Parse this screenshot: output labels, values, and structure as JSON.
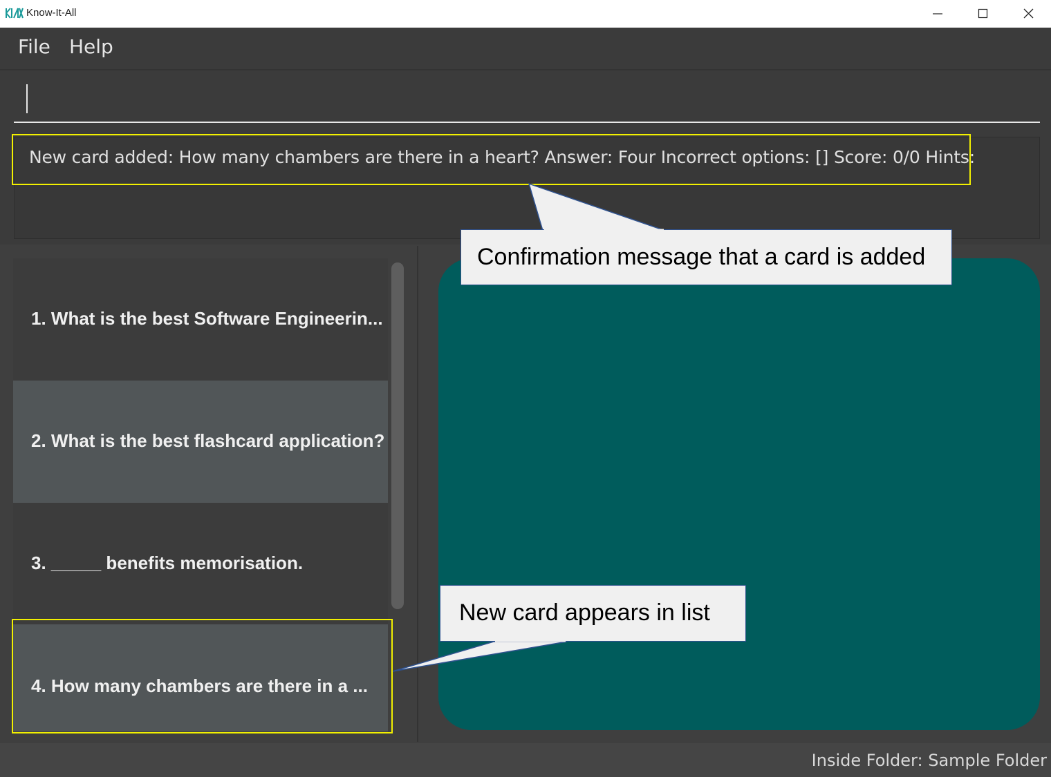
{
  "window": {
    "title": "Know-It-All",
    "icon": "kia-logo-icon",
    "controls": [
      "minimize-icon",
      "maximize-icon",
      "close-icon"
    ]
  },
  "menu": {
    "items": [
      {
        "label": "File"
      },
      {
        "label": "Help"
      }
    ]
  },
  "command_box": {
    "value": "",
    "placeholder": ""
  },
  "result_display": {
    "text": "New card added: How many chambers are there in a heart? Answer: Four Incorrect options: [] Score: 0/0 Hints:"
  },
  "card_list": {
    "items": [
      {
        "label": "1.  What is the best Software Engineerin..."
      },
      {
        "label": "2.  What is the best flashcard application?"
      },
      {
        "label": "3.  _____ benefits memorisation."
      },
      {
        "label": "4.  How many chambers are there in a ..."
      }
    ]
  },
  "annotations": {
    "callout_result": "Confirmation message that a card is added",
    "callout_list": "New card appears in list"
  },
  "status_bar": {
    "folder": "Inside Folder: Sample Folder"
  },
  "colors": {
    "background": "#3f3f3f",
    "display_card": "#005c5c",
    "highlight": "#f2f000",
    "callout_fill": "#f0f0f0",
    "callout_border": "#2f528f"
  }
}
